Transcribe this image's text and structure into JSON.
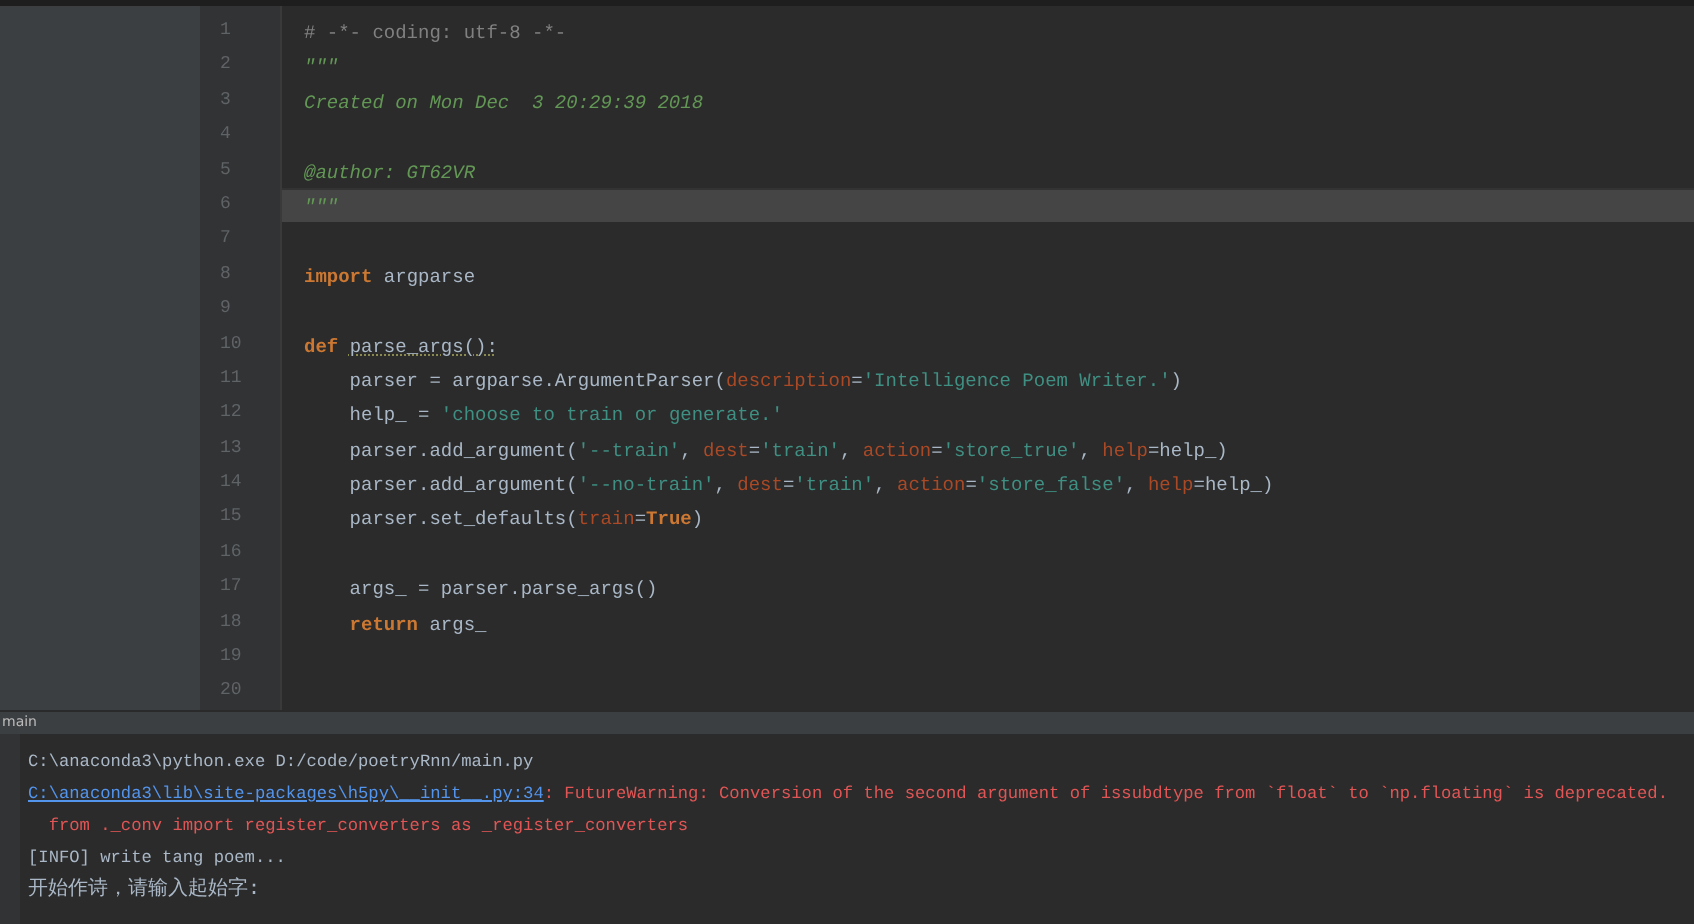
{
  "editor": {
    "lines": [
      {
        "number": "1",
        "current": false,
        "tokens": [
          {
            "kind": "comment",
            "text": "# -*- coding: utf-8 -*-"
          }
        ]
      },
      {
        "number": "2",
        "current": false,
        "tokens": [
          {
            "kind": "docstring",
            "text": "\"\"\""
          }
        ]
      },
      {
        "number": "3",
        "current": false,
        "tokens": [
          {
            "kind": "docstring",
            "text": "Created on Mon Dec  3 20:29:39 2018"
          }
        ]
      },
      {
        "number": "4",
        "current": false
      },
      {
        "number": "5",
        "current": false,
        "tokens": [
          {
            "kind": "docstring",
            "text": "@author: GT62VR"
          }
        ]
      },
      {
        "number": "6",
        "current": true,
        "tokens": [
          {
            "kind": "docstring",
            "text": "\"\"\""
          }
        ]
      },
      {
        "number": "7",
        "current": false
      },
      {
        "number": "8",
        "current": false,
        "tokens": [
          {
            "kind": "keyword",
            "text": "import"
          },
          {
            "kind": "plain",
            "text": " argparse"
          }
        ]
      },
      {
        "number": "9",
        "current": false
      },
      {
        "number": "10",
        "current": false,
        "tokens": [
          {
            "kind": "keyword",
            "text": "def "
          },
          {
            "kind": "function",
            "text": "parse_args():"
          }
        ]
      },
      {
        "number": "11",
        "current": false,
        "tokens": [
          {
            "kind": "plain",
            "text": "    parser = argparse.ArgumentParser("
          },
          {
            "kind": "param",
            "text": "description"
          },
          {
            "kind": "plain",
            "text": "="
          },
          {
            "kind": "string",
            "text": "'Intelligence Poem Writer.'"
          },
          {
            "kind": "plain",
            "text": ")"
          }
        ]
      },
      {
        "number": "12",
        "current": false,
        "tokens": [
          {
            "kind": "plain",
            "text": "    help_ = "
          },
          {
            "kind": "string",
            "text": "'choose to train or generate.'"
          }
        ]
      },
      {
        "number": "13",
        "current": false,
        "tokens": [
          {
            "kind": "plain",
            "text": "    parser.add_argument("
          },
          {
            "kind": "string",
            "text": "'--train'"
          },
          {
            "kind": "plain",
            "text": ", "
          },
          {
            "kind": "param",
            "text": "dest"
          },
          {
            "kind": "plain",
            "text": "="
          },
          {
            "kind": "string",
            "text": "'train'"
          },
          {
            "kind": "plain",
            "text": ", "
          },
          {
            "kind": "param",
            "text": "action"
          },
          {
            "kind": "plain",
            "text": "="
          },
          {
            "kind": "string",
            "text": "'store_true'"
          },
          {
            "kind": "plain",
            "text": ", "
          },
          {
            "kind": "param",
            "text": "help"
          },
          {
            "kind": "plain",
            "text": "=help_)"
          }
        ]
      },
      {
        "number": "14",
        "current": false,
        "tokens": [
          {
            "kind": "plain",
            "text": "    parser.add_argument("
          },
          {
            "kind": "string",
            "text": "'--no-train'"
          },
          {
            "kind": "plain",
            "text": ", "
          },
          {
            "kind": "param",
            "text": "dest"
          },
          {
            "kind": "plain",
            "text": "="
          },
          {
            "kind": "string",
            "text": "'train'"
          },
          {
            "kind": "plain",
            "text": ", "
          },
          {
            "kind": "param",
            "text": "action"
          },
          {
            "kind": "plain",
            "text": "="
          },
          {
            "kind": "string",
            "text": "'store_false'"
          },
          {
            "kind": "plain",
            "text": ", "
          },
          {
            "kind": "param",
            "text": "help"
          },
          {
            "kind": "plain",
            "text": "=help_)"
          }
        ]
      },
      {
        "number": "15",
        "current": false,
        "tokens": [
          {
            "kind": "plain",
            "text": "    parser.set_defaults("
          },
          {
            "kind": "param",
            "text": "train"
          },
          {
            "kind": "plain",
            "text": "="
          },
          {
            "kind": "keyword",
            "text": "True"
          },
          {
            "kind": "plain",
            "text": ")"
          }
        ]
      },
      {
        "number": "16",
        "current": false
      },
      {
        "number": "17",
        "current": false,
        "tokens": [
          {
            "kind": "plain",
            "text": "    args_ = parser.parse_args()"
          }
        ]
      },
      {
        "number": "18",
        "current": false,
        "tokens": [
          {
            "kind": "keyword",
            "text": "    return"
          },
          {
            "kind": "plain",
            "text": " args_"
          }
        ]
      },
      {
        "number": "19",
        "current": false
      },
      {
        "number": "20",
        "current": false
      }
    ]
  },
  "run_panel": {
    "title": "main",
    "lines": [
      [
        {
          "kind": "plain",
          "text": "C:\\anaconda3\\python.exe D:/code/poetryRnn/main.py"
        }
      ],
      [
        {
          "kind": "link",
          "text": "C:\\anaconda3\\lib\\site-packages\\h5py\\__init__.py:34"
        },
        {
          "kind": "error",
          "text": ": FutureWarning: Conversion of the second argument of issubdtype from `float` to `np.floating` is deprecated."
        }
      ],
      [
        {
          "kind": "error",
          "text": "  from ._conv import register_converters as _register_converters"
        }
      ],
      [
        {
          "kind": "plain",
          "text": "[INFO] write tang poem..."
        }
      ],
      [
        {
          "kind": "plain",
          "text": "开始作诗，请输入起始字:"
        }
      ]
    ]
  }
}
